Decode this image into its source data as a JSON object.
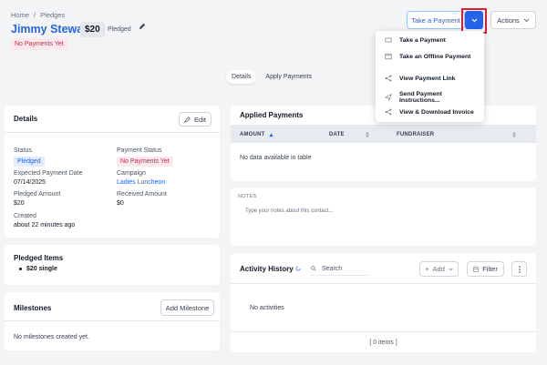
{
  "breadcrumb": {
    "home": "Home",
    "sep": "/",
    "current": "Pledges"
  },
  "header": {
    "name": "Jimmy Stewart",
    "amount": "$20",
    "pledged_label": "Pledged",
    "status": "No Payments Yet"
  },
  "toolbar": {
    "take_payment": "Take a Payment",
    "actions": "Actions"
  },
  "dropdown": {
    "items": [
      {
        "label": "Take a Payment",
        "icon": "card-icon"
      },
      {
        "label": "Take an Offline Payment",
        "icon": "window-icon"
      },
      {
        "label": "View Payment Link",
        "icon": "link-icon"
      },
      {
        "label": "Send Payment Instructions...",
        "icon": "send-icon"
      },
      {
        "label": "View & Download Invoice",
        "icon": "share-icon"
      }
    ]
  },
  "tabs": [
    {
      "label": "Details",
      "active": true
    },
    {
      "label": "Apply Payments",
      "active": false
    }
  ],
  "details": {
    "title": "Details",
    "edit": "Edit",
    "status_label": "Status",
    "status_value": "Pledged",
    "payment_status_label": "Payment Status",
    "payment_status_value": "No Payments Yet",
    "expected_label": "Expected Payment Date",
    "expected_value": "07/14/2025",
    "campaign_label": "Campaign",
    "campaign_value": "Ladies Luncheon",
    "pledged_amount_label": "Pledged Amount",
    "pledged_amount_value": "$20",
    "received_label": "Received Amount",
    "received_value": "$0",
    "created_label": "Created",
    "created_value": "about 22 minutes ago"
  },
  "pledged_items": {
    "title": "Pledged Items",
    "items": [
      "$20 single"
    ]
  },
  "milestones": {
    "title": "Milestones",
    "add": "Add Milestone",
    "empty": "No milestones created yet."
  },
  "applied_payments": {
    "title": "Applied Payments",
    "columns": [
      "AMOUNT",
      "DATE",
      "FUNDRAISER"
    ],
    "empty": "No data available in table"
  },
  "notes": {
    "label": "NOTES",
    "placeholder": "Type your notes about this contact..."
  },
  "activity": {
    "title": "Activity History",
    "search_placeholder": "Search",
    "add": "Add",
    "filter": "Filter",
    "empty": "No activities",
    "count": "[ 0 items ]"
  },
  "colors": {
    "accent": "#2563eb",
    "highlight": "#e11d2a",
    "pink_bg": "#fce7ec",
    "pink_text": "#b4324e"
  }
}
